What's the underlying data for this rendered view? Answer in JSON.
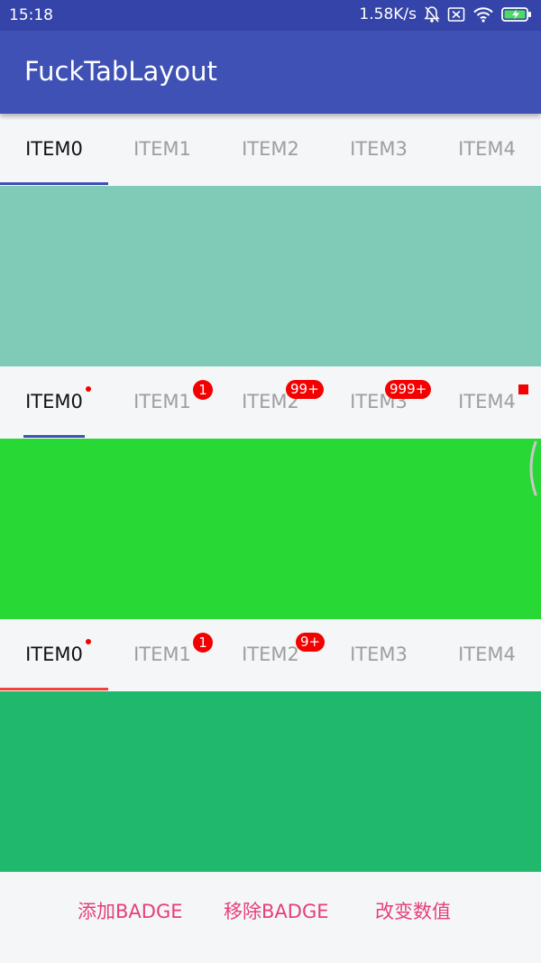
{
  "status_bar": {
    "time": "15:18",
    "network_speed": "1.58K/s",
    "icons": [
      "mute-bell-icon",
      "sim-blocked-icon",
      "wifi-icon",
      "battery-charging-icon"
    ]
  },
  "app_bar": {
    "title": "FuckTabLayout"
  },
  "tab_layouts": [
    {
      "indicator_color": "#3f51b5",
      "tabs": [
        {
          "label": "ITEM0",
          "selected": true
        },
        {
          "label": "ITEM1",
          "selected": false
        },
        {
          "label": "ITEM2",
          "selected": false
        },
        {
          "label": "ITEM3",
          "selected": false
        },
        {
          "label": "ITEM4",
          "selected": false
        }
      ],
      "panel_color": "#80cbb8"
    },
    {
      "indicator_color": "#3f51b5",
      "tabs": [
        {
          "label": "ITEM0",
          "selected": true,
          "badge": "dot"
        },
        {
          "label": "ITEM1",
          "selected": false,
          "badge": "1"
        },
        {
          "label": "ITEM2",
          "selected": false,
          "badge": "99+"
        },
        {
          "label": "ITEM3",
          "selected": false,
          "badge": "999+"
        },
        {
          "label": "ITEM4",
          "selected": false,
          "badge": "square"
        }
      ],
      "panel_color": "#28d935"
    },
    {
      "indicator_color": "#f44336",
      "tabs": [
        {
          "label": "ITEM0",
          "selected": true,
          "badge": "dot"
        },
        {
          "label": "ITEM1",
          "selected": false,
          "badge": "1"
        },
        {
          "label": "ITEM2",
          "selected": false,
          "badge": "9+"
        },
        {
          "label": "ITEM3",
          "selected": false
        },
        {
          "label": "ITEM4",
          "selected": false
        }
      ],
      "panel_color": "#20b86c"
    }
  ],
  "actions": {
    "add_badge": "添加BADGE",
    "remove_badge": "移除BADGE",
    "change_value": "改变数值"
  },
  "colors": {
    "primary": "#3f51b5",
    "primary_dark": "#3544a8",
    "accent": "#e53f78",
    "badge_red": "#f40000"
  }
}
